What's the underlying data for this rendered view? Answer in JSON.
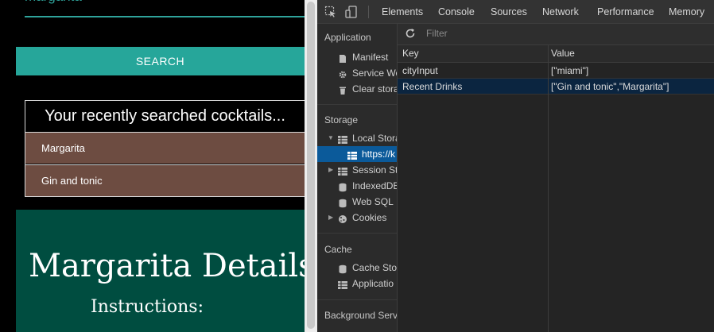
{
  "app": {
    "search_value": "margarita",
    "search_button": "SEARCH",
    "recent_title": "Your recently searched cocktails...",
    "recent_items": [
      "Margarita",
      "Gin and tonic"
    ],
    "details_title": "Margarita Details",
    "instructions_label": "Instructions:",
    "colors": {
      "accent": "#26a69a",
      "recent_item_bg": "#6d4c41",
      "details_bg": "#004d40"
    }
  },
  "devtools": {
    "tabs": [
      "Elements",
      "Console",
      "Sources",
      "Network",
      "Performance",
      "Memory"
    ],
    "toolbar_icons": [
      "inspect-element-icon",
      "device-toggle-icon"
    ],
    "sidebar": {
      "application_header": "Application",
      "application_items": [
        "Manifest",
        "Service Wo",
        "Clear stora"
      ],
      "storage_header": "Storage",
      "storage_items": [
        "Local Stora",
        "https://k",
        "Session Sto",
        "IndexedDB",
        "Web SQL",
        "Cookies"
      ],
      "cache_header": "Cache",
      "cache_items": [
        "Cache Stor",
        "Applicatio"
      ],
      "background_header": "Background Servi"
    },
    "filter_placeholder": "Filter",
    "table": {
      "headers": [
        "Key",
        "Value"
      ],
      "rows": [
        {
          "key": "cityInput",
          "value": "[\"miami\"]"
        },
        {
          "key": "Recent Drinks",
          "value": "[\"Gin and tonic\",\"Margarita\"]"
        }
      ]
    },
    "colors": {
      "selected_row": "#0b2540",
      "selected_sidebar": "#0b5a9a"
    }
  }
}
